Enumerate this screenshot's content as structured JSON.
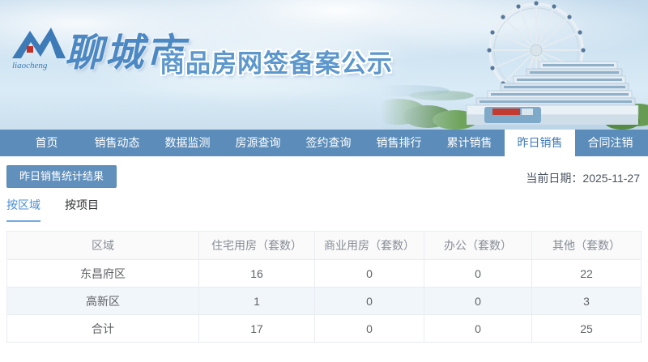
{
  "header": {
    "logo_script": "liaocheng",
    "brand": "聊城市",
    "title": "商品房网签备案公示"
  },
  "nav": {
    "items": [
      {
        "label": "首页",
        "active": false
      },
      {
        "label": "销售动态",
        "active": false
      },
      {
        "label": "数据监测",
        "active": false
      },
      {
        "label": "房源查询",
        "active": false
      },
      {
        "label": "签约查询",
        "active": false
      },
      {
        "label": "销售排行",
        "active": false
      },
      {
        "label": "累计销售",
        "active": false
      },
      {
        "label": "昨日销售",
        "active": true
      },
      {
        "label": "合同注销",
        "active": false
      }
    ]
  },
  "toolbar": {
    "result_button_label": "昨日销售统计结果",
    "current_date_label": "当前日期：",
    "current_date_value": "2025-11-27"
  },
  "view_tabs": [
    {
      "label": "按区域",
      "active": true
    },
    {
      "label": "按项目",
      "active": false
    }
  ],
  "table": {
    "columns": [
      "区域",
      "住宅用房（套数）",
      "商业用房（套数）",
      "办公（套数）",
      "其他（套数）"
    ],
    "rows": [
      {
        "cells": [
          "东昌府区",
          "16",
          "0",
          "0",
          "22"
        ]
      },
      {
        "cells": [
          "高新区",
          "1",
          "0",
          "0",
          "3"
        ]
      },
      {
        "cells": [
          "合计",
          "17",
          "0",
          "0",
          "25"
        ]
      }
    ]
  },
  "colors": {
    "nav_bg": "#5b8cba",
    "nav_active_text": "#3e7bb7",
    "button_bg": "#6290bd",
    "tab_active": "#4a8fd4",
    "tab_underline": "#74a9e8",
    "table_header_bg": "#fafafa",
    "table_alt_row_bg": "#f1f6fb",
    "title_blue": "#5c97cd",
    "logo_red": "#c03028"
  }
}
